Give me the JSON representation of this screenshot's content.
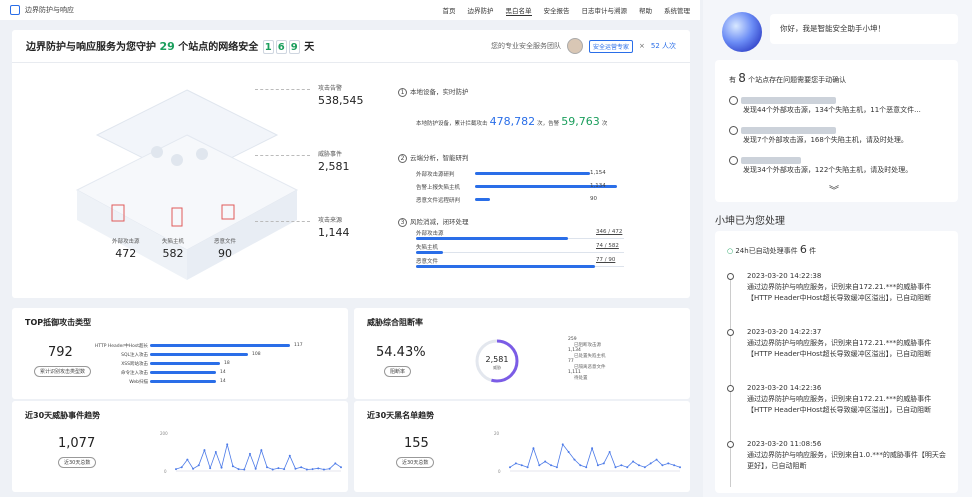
{
  "app": {
    "title": "边界防护与响应"
  },
  "nav": [
    "首页",
    "边界防护",
    "黑白名单",
    "安全报告",
    "日志审计与溯源",
    "帮助",
    "系统管理"
  ],
  "header": {
    "title_prefix": "边界防护与响应服务为您守护",
    "sites": "29",
    "title_mid": "个站点的网络安全",
    "days": [
      "1",
      "6",
      "9"
    ],
    "days_unit": "天",
    "service_label": "您的专业安全服务团队",
    "expert_tag": "安全运营专家",
    "people": "52 人次"
  },
  "stats": [
    {
      "label": "攻击告警",
      "value": "538,545"
    },
    {
      "label": "威胁事件",
      "value": "2,581"
    },
    {
      "label": "攻击来源",
      "value": "1,144"
    }
  ],
  "iso_labels": [
    {
      "label": "外部攻击源",
      "value": "472"
    },
    {
      "label": "失陷主机",
      "value": "582"
    },
    {
      "label": "恶意文件",
      "value": "90"
    }
  ],
  "steps": {
    "s1": {
      "n": "1",
      "title": "本地设备，实时防护",
      "line_pre": "本地防护设备，累计拦截攻击",
      "v1": "478,782",
      "mid": "次，告警",
      "v2": "59,763",
      "unit": "次"
    },
    "s2": {
      "n": "2",
      "title": "云端分析，智能研判",
      "rows": [
        {
          "label": "外部攻击源研判",
          "value": "1,154",
          "pct": 0.78
        },
        {
          "label": "告警上报失陷主机",
          "value": "1,134",
          "pct": 0.96
        },
        {
          "label": "恶意文件远程研判",
          "value": "90",
          "pct": 0.1
        }
      ]
    },
    "s3": {
      "n": "3",
      "title": "风险消减，闭环处理",
      "rows": [
        {
          "label": "外部攻击源",
          "value": "346 / 472",
          "pct": 0.73
        },
        {
          "label": "失陷主机",
          "value": "74 / 582",
          "pct": 0.13
        },
        {
          "label": "恶意文件",
          "value": "77 / 90",
          "pct": 0.86
        }
      ]
    }
  },
  "top_attack": {
    "title": "TOP抵御攻击类型",
    "count": "792",
    "pill": "累计识别攻击类型数",
    "items": [
      {
        "label": "HTTP Header中Host超长",
        "value": "117",
        "pct": 1.0
      },
      {
        "label": "SQL注入攻击",
        "value": "108",
        "pct": 0.7
      },
      {
        "label": "XSS跨站攻击",
        "value": "18",
        "pct": 0.5
      },
      {
        "label": "命令注入攻击",
        "value": "14",
        "pct": 0.47
      },
      {
        "label": "Web扫描",
        "value": "14",
        "pct": 0.47
      }
    ]
  },
  "threat_rate": {
    "title": "威胁综合阻断率",
    "rate": "54.43%",
    "pill": "阻断率",
    "center_value": "2,581",
    "center_label": "威胁",
    "legend": [
      {
        "v": "259",
        "t": "已阻断攻击源"
      },
      {
        "v": "1,134",
        "t": "已处置失陷主机"
      },
      {
        "v": "77",
        "t": "已隔离恶意文件"
      },
      {
        "v": "1,111",
        "t": "待处置"
      }
    ]
  },
  "trend30": {
    "title": "近30天威胁事件趋势",
    "count": "1,077",
    "pill": "近30天总数",
    "ymax": "200",
    "ymin": "0",
    "values": [
      10,
      20,
      60,
      12,
      30,
      110,
      15,
      100,
      18,
      140,
      25,
      10,
      8,
      90,
      12,
      110,
      20,
      8,
      15,
      10,
      80,
      12,
      20,
      8,
      10,
      14,
      8,
      12,
      40,
      20
    ]
  },
  "black30": {
    "title": "近30天黑名单趋势",
    "count": "155",
    "pill": "近30天总数",
    "ymax": "20",
    "ymin": "0",
    "values": [
      2,
      4,
      3,
      2,
      12,
      3,
      5,
      3,
      2,
      14,
      10,
      6,
      3,
      2,
      12,
      3,
      4,
      10,
      2,
      3,
      2,
      5,
      3,
      2,
      4,
      6,
      3,
      4,
      3,
      2
    ]
  },
  "assistant": {
    "greeting": "你好，我是智能安全助手小坤！",
    "confirm_pre": "有",
    "confirm_num": "8",
    "confirm_post": "个站点存在问题需要您手动确认",
    "items": [
      "发现44个外部攻击源，134个失陷主机，11个恶意文件...",
      "发现7个外部攻击源，168个失陷主机，请及时处理。",
      "发现34个外部攻击源，122个失陷主机，请及时处理。"
    ],
    "handled_title": "小坤已为您处理",
    "auto_pre": "24h已自动处理事件",
    "auto_num": "6",
    "auto_unit": "件",
    "events": [
      {
        "time": "2023-03-20 14:22:38",
        "text": "通过边界防护与响应服务，识别来自172.21.***的威胁事件【HTTP Header中Host超长导致缓冲区溢出】，已自动阻断"
      },
      {
        "time": "2023-03-20 14:22:37",
        "text": "通过边界防护与响应服务，识别来自172.21.***的威胁事件【HTTP Header中Host超长导致缓冲区溢出】，已自动阻断"
      },
      {
        "time": "2023-03-20 14:22:36",
        "text": "通过边界防护与响应服务，识别来自172.21.***的威胁事件【HTTP Header中Host超长导致缓冲区溢出】，已自动阻断"
      },
      {
        "time": "2023-03-20 11:08:56",
        "text": "通过边界防护与响应服务，识别来自1.0.***的威胁事件【明天会更好】，已自动阻断"
      }
    ]
  }
}
